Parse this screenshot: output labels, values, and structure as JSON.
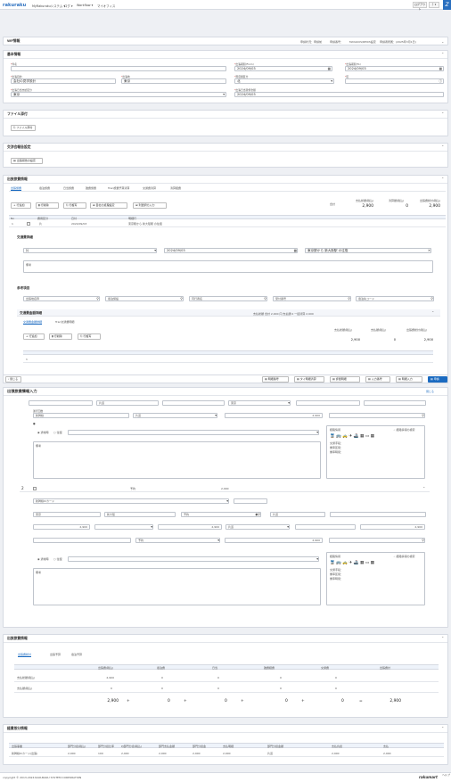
{
  "header": {
    "logo": "rakuraku",
    "menu": [
      "MyRakurakuシステム ▾",
      "ログ ▾",
      "Workflow ▾",
      "マイオフィス"
    ],
    "user": "ログアウト",
    "help": "？▾",
    "brand": "Z"
  },
  "sections": {
    "form_info": {
      "title": "WF情報",
      "meta": [
        "申請状況：申請前",
        "申請番号：",
        "MAYAKUS/REI0S設定",
        "申請者所属：(2025年3月1日)"
      ]
    },
    "basic": {
      "title": "基本情報",
      "fields": [
        {
          "label": "件名",
          "value": ""
        },
        {
          "label": "出張期間(From)",
          "value": "2024/09/03"
        },
        {
          "label": "出張期間(To)",
          "value": "2024/09/03"
        },
        {
          "label": "出張目的",
          "value": "会社の見学設計"
        },
        {
          "label": "出張地",
          "value": "東京"
        },
        {
          "label": "限度額区分",
          "value": "北"
        },
        {
          "label": "区",
          "value": ""
        },
        {
          "label": "出張日当支給区分",
          "value": "東京"
        },
        {
          "label": "出張日当受領金額",
          "value": "2024/09/03"
        }
      ]
    },
    "attach": {
      "title": "ファイル添付",
      "button": "ファイル添付"
    },
    "prior": {
      "title": "交渉会報告設定",
      "button": "出張報告の設定"
    },
    "expense": {
      "title": "出張旅費情報",
      "tabs": [
        "出張旅費",
        "宿泊旅費",
        "日当旅費",
        "雑費旅費",
        "Tran旅費予算清算",
        "交通費清算",
        "清算経費"
      ],
      "buttons": [
        "行追加",
        "行削除",
        "行複写",
        "自社の処理設定",
        "列選択の入力"
      ],
      "summary": {
        "labels": [
          "支払総額(税込)",
          "清算額(税込)",
          "出張費総計(税込)"
        ],
        "values": [
          "2,900",
          "0",
          "2,900"
        ],
        "prefix": "合計"
      },
      "table_head": [
        "No",
        "",
        "費用区分",
        "日付",
        "明細行"
      ],
      "row1": {
        "no": "1",
        "type": "片",
        "date": "2024/09/03",
        "desc": "東京駅から 新大阪駅 の往復"
      },
      "transport": {
        "title": "交通費詳細",
        "from": "片",
        "date": "2024/09/03",
        "to": "東京駅から 新大阪駅 の往復",
        "note_label": "備考",
        "note_placeholder": "備考"
      },
      "extra": {
        "title": "参考項目",
        "placeholders": [
          "出張地名称",
          "宿泊施設",
          "同行者名",
          "受付番号",
          "宿泊先コード"
        ]
      }
    },
    "trans_detail": {
      "title": "交通費金額詳細",
      "meta": "支払総額 合計 2,900 円  支払額 0  一括清算 2,900",
      "tabs": [
        "交通費金額詳細",
        "Tran交通費明細"
      ],
      "buttons": [
        "行追加",
        "行削除",
        "行複写"
      ],
      "labels": [
        "支払総額(税込)",
        "支払額(税込)",
        "出張費総計(税込)"
      ],
      "values": [
        "2,900",
        "0",
        "2,900"
      ]
    },
    "modal": {
      "title": "出張旅費情報入力",
      "close": "閉じる",
      "actions": [
        "明細番号",
        "タイ明細清算",
        "評価明細",
        "入力番号",
        "明細入力"
      ],
      "save": "申請"
    },
    "line1": {
      "no": "1",
      "fare": "2,900",
      "ticket": "運行回数",
      "route": "出張地",
      "fields": [
        "新幹線",
        "片道",
        "",
        "東京",
        "新大阪",
        "",
        "",
        "",
        "",
        ""
      ],
      "radio": [
        "通常時",
        "往復"
      ],
      "note": "備考",
      "route_title": "経路情報",
      "route_label": "経路情報の検索",
      "route_info": [
        "交通手段：",
        "乗車区間：",
        "乗車時間："
      ]
    },
    "line2": {
      "no": "2",
      "label": "予約",
      "fare": "2,900",
      "fields": [
        "新幹線ICカード",
        "東京",
        "新大阪",
        "予約",
        "片道",
        "2,900",
        "2,900",
        "",
        "片道",
        "予約"
      ],
      "radio": [
        "通常時",
        "往復"
      ],
      "note": "備考",
      "route_title": "経路情報",
      "route_label": "経路情報の検索",
      "route_info": [
        "交通手段：",
        "乗車区間：",
        "乗車時間："
      ]
    },
    "totals": {
      "title": "出張旅費情報",
      "tabs": [
        "出張費総計",
        "出張予算",
        "宿泊予算"
      ],
      "cols": [
        "出張費(税込)",
        "宿泊費",
        "日当",
        "雑費経費",
        "交通費",
        "出張費計"
      ],
      "rows": [
        {
          "label": "支払総額(税込)",
          "values": [
            "2,900",
            "0",
            "0",
            "0",
            "0",
            ""
          ]
        },
        {
          "label": "支払額(税込)",
          "values": [
            "0",
            "0",
            "0",
            "0",
            "0",
            ""
          ]
        }
      ],
      "grand": [
        "2,900",
        "0",
        "0",
        "0",
        "0",
        "2,900"
      ],
      "ops": [
        "+",
        "+",
        "+",
        "+",
        "="
      ]
    },
    "cost": {
      "title": "経費按分情報",
      "cols": [
        "出張事業",
        "部門分担(税込)",
        "部門分担比率",
        "PJ部門分担(税込)",
        "部門支払金額",
        "部門分担金",
        "支払明細",
        "部門分担金額",
        "支払負担",
        "支払"
      ],
      "row": [
        "新幹線ICカード(出張)",
        "2,900",
        "100",
        "2,900",
        "2,900",
        "2,900",
        "2,900",
        "片道",
        "2,900",
        "2,900"
      ]
    }
  },
  "footer": {
    "copyright": "copyright © 2013-2024 RAKURAKU SYSTEM CORPORATION",
    "brand": "rakumart",
    "help": "ヘルプ"
  }
}
